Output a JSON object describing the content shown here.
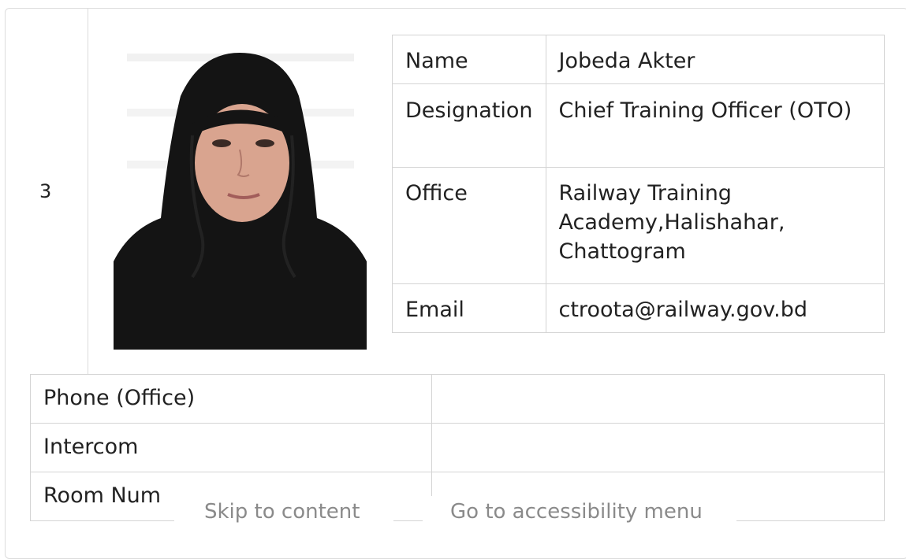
{
  "row": {
    "serial": "3",
    "photo_icon": "person-portrait-icon",
    "info": [
      {
        "label": "Name",
        "value": "Jobeda Akter"
      },
      {
        "label": "Designation",
        "value": "Chief Training Officer (OTO)"
      },
      {
        "label": "Office",
        "value": "Railway Training Academy,Halishahar, Chattogram"
      },
      {
        "label": "Email",
        "value": "ctroota@railway.gov.bd"
      }
    ],
    "contact": [
      {
        "label": "Phone (Office)",
        "value": ""
      },
      {
        "label": "Intercom",
        "value": ""
      },
      {
        "label": "Room Num",
        "value": ""
      }
    ]
  },
  "skip_links": {
    "content": "Skip to content",
    "accessibility": "Go to accessibility menu"
  }
}
